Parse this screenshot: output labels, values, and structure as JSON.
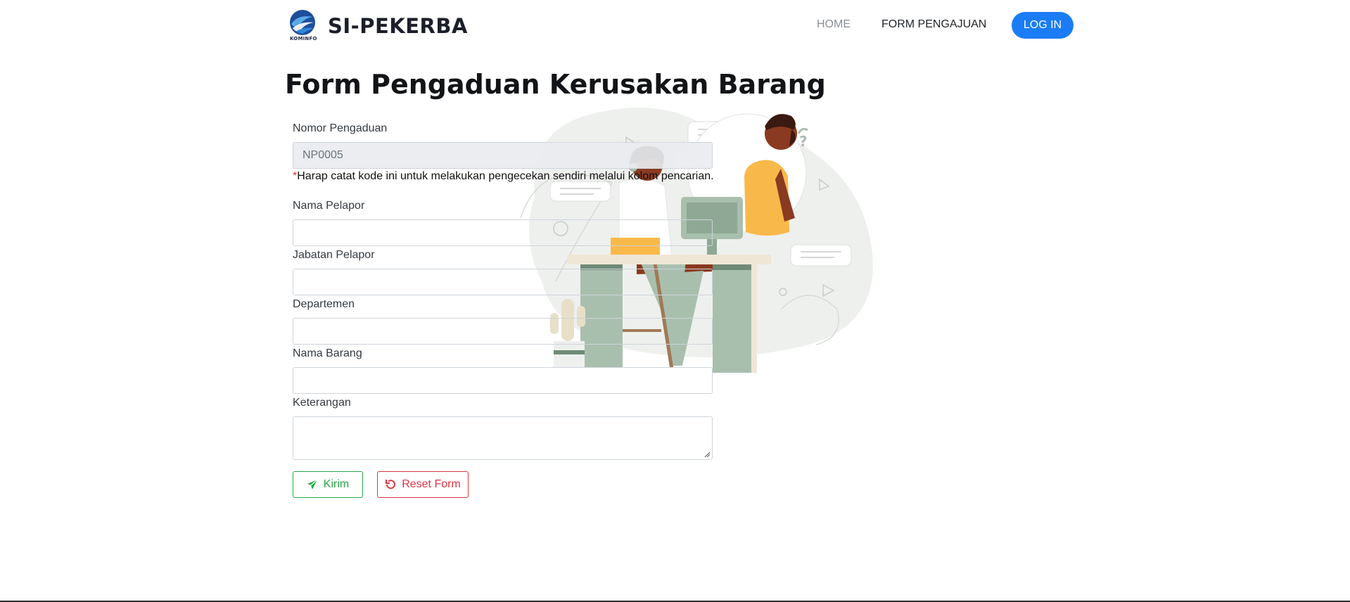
{
  "brand": {
    "name": "SI-PEKERBA",
    "logo_text": "KOMINFO",
    "logo_icon": "kominfo-logo"
  },
  "nav": {
    "home": "HOME",
    "form": "FORM PENGAJUAN",
    "login": "LOG IN"
  },
  "page": {
    "title": "Form Pengaduan Kerusakan Barang"
  },
  "form": {
    "nomor_label": "Nomor Pengaduan",
    "nomor_value": "NP0005",
    "hint_star": "*",
    "hint_text": "Harap catat kode ini untuk melakukan pengecekan sendiri melalui kolom pencarian.",
    "nama_pelapor_label": "Nama Pelapor",
    "jabatan_label": "Jabatan Pelapor",
    "departemen_label": "Departemen",
    "nama_barang_label": "Nama Barang",
    "keterangan_label": "Keterangan"
  },
  "buttons": {
    "send": "Kirim",
    "send_icon": "paper-plane-icon",
    "reset": "Reset Form",
    "reset_icon": "undo-icon"
  },
  "colors": {
    "primary": "#1a7df5",
    "success": "#28a745",
    "danger": "#dc3545"
  }
}
